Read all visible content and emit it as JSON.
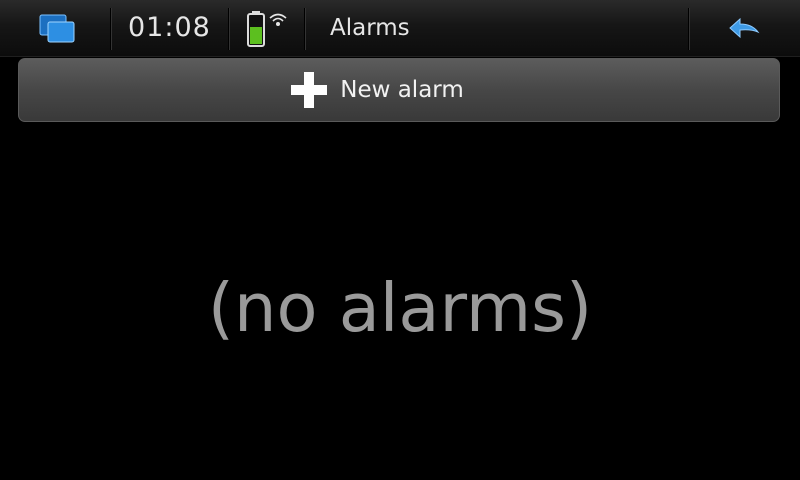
{
  "statusbar": {
    "time": "01:08",
    "title": "Alarms",
    "icons": {
      "task_switcher": "task-switcher-icon",
      "battery": "battery-icon",
      "wifi": "wifi-icon",
      "back": "back-arrow-icon"
    },
    "battery_level": 0.55
  },
  "actions": {
    "new_alarm_label": "New alarm",
    "new_alarm_icon": "plus-icon"
  },
  "content": {
    "empty_text": "(no alarms)"
  },
  "colors": {
    "accent_blue": "#3f9be6",
    "battery_green": "#5cbf1f",
    "background": "#000000"
  }
}
